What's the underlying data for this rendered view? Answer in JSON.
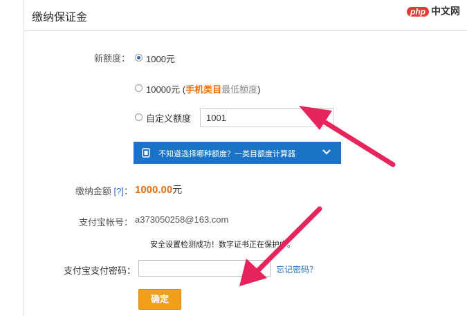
{
  "header": {
    "title": "缴纳保证金",
    "watermark_badge": "php",
    "watermark_text": "中文网"
  },
  "form": {
    "quota_label": "新额度：",
    "options": [
      {
        "text": "1000元",
        "checked": true
      },
      {
        "text_before": "10000元 (",
        "highlight": "手机类目",
        "muted": "最低额度",
        "text_after": ")",
        "checked": false
      },
      {
        "text": "自定义额度",
        "checked": false
      }
    ],
    "custom_value": "1001",
    "calc_bar": {
      "text": "不知道选择哪种额度？一类目额度计算器"
    },
    "amount_label": "缴纳金额 ",
    "amount_help": "[?]",
    "amount_colon": "：",
    "amount_value": "1000.00",
    "amount_unit": "元",
    "account_label": "支付宝帐号：",
    "account_value": "a373050258@163.com",
    "notice": "安全设置检测成功！数字证书正在保护中。",
    "password_label": "支付宝支付密码：",
    "password_value": "",
    "forgot_link": "忘记密码？",
    "confirm_button": "确定"
  },
  "colors": {
    "accent": "#1a73c6",
    "highlight": "#f26d00",
    "button": "#f29f1a",
    "arrow": "#e8245c"
  }
}
